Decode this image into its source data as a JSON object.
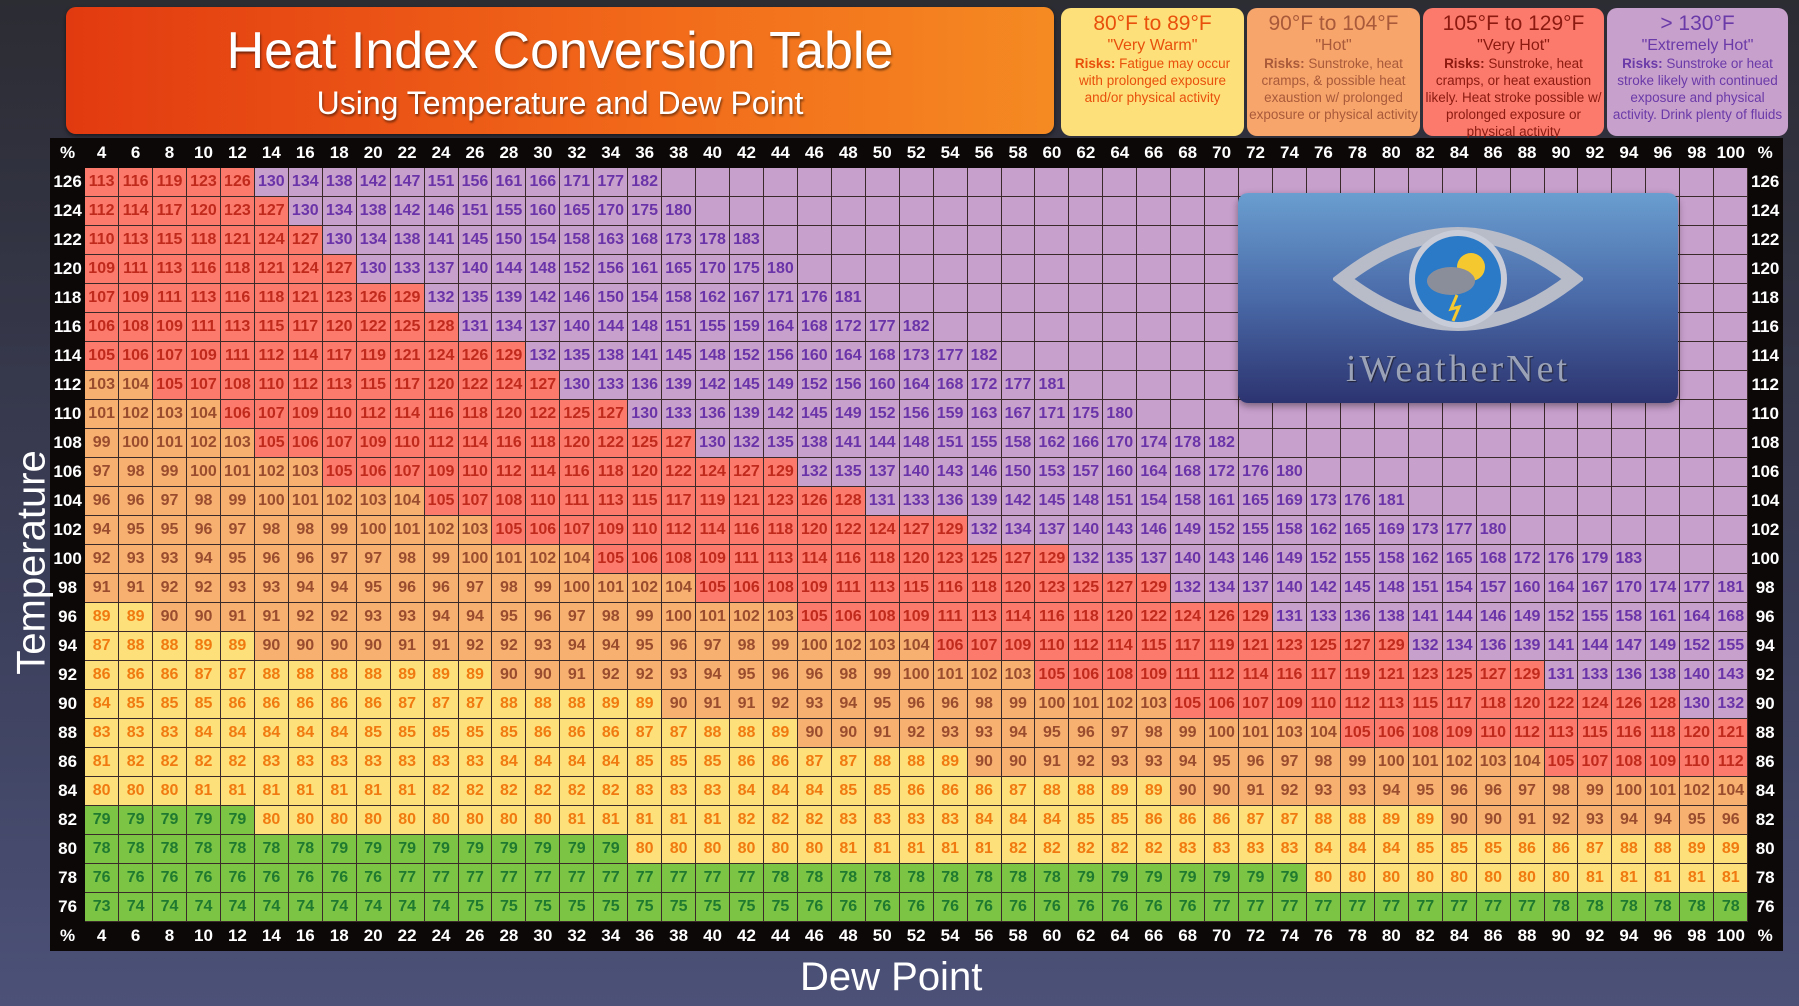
{
  "header": {
    "title": "Heat Index Conversion Table",
    "subtitle": "Using Temperature and Dew Point"
  },
  "legend": [
    {
      "range": "80°F to 89°F",
      "name": "\"Very Warm\"",
      "risks_label": "Risks:",
      "risks": "Fatigue may occur with prolonged exposure and/or physical activity",
      "color": "#fde07a"
    },
    {
      "range": "90°F to 104°F",
      "name": "\"Hot\"",
      "risks_label": "Risks:",
      "risks": "Sunstroke, heat cramps, & possible heat exaustion w/ prolonged exposure or physical activity",
      "color": "#f8b070"
    },
    {
      "range": "105°F to 129°F",
      "name": "\"Very Hot\"",
      "risks_label": "Risks:",
      "risks": "Sunstroke, heat cramps, or heat exaustion likely. Heat stroke possible w/ prolonged exposure or physical activity",
      "color": "#fb7a6c"
    },
    {
      "range": "> 130°F",
      "name": "\"Extremely Hot\"",
      "risks_label": "Risks:",
      "risks": "Sunstroke or heat stroke likely with continued exposure and physical activity. Drink plenty of fluids",
      "color": "#c8a0cc"
    }
  ],
  "logo": {
    "brand": "iWeatherNet"
  },
  "chart_data": {
    "type": "heatmap",
    "title": "Heat Index Conversion Table",
    "subtitle": "Using Temperature and Dew Point",
    "xlabel": "Dew Point",
    "ylabel": "Temperature",
    "corner_label": "%",
    "x": [
      4,
      6,
      8,
      10,
      12,
      14,
      16,
      18,
      20,
      22,
      24,
      26,
      28,
      30,
      32,
      34,
      36,
      38,
      40,
      42,
      44,
      46,
      48,
      50,
      52,
      54,
      56,
      58,
      60,
      62,
      64,
      66,
      68,
      70,
      72,
      74,
      76,
      78,
      80,
      82,
      84,
      86,
      88,
      90,
      92,
      94,
      96,
      98,
      100
    ],
    "y": [
      126,
      124,
      122,
      120,
      118,
      116,
      114,
      112,
      110,
      108,
      106,
      104,
      102,
      100,
      98,
      96,
      94,
      92,
      90,
      88,
      86,
      84,
      82,
      80,
      78,
      76
    ],
    "color_bands": [
      {
        "min": 0,
        "max": 79,
        "color": "#7cc444"
      },
      {
        "min": 80,
        "max": 89,
        "color": "#fde07a"
      },
      {
        "min": 90,
        "max": 104,
        "color": "#f8b070"
      },
      {
        "min": 105,
        "max": 129,
        "color": "#fb7a6c"
      },
      {
        "min": 130,
        "max": 999,
        "color": "#c8a0cc"
      }
    ],
    "values": [
      [
        113,
        116,
        119,
        123,
        126,
        130,
        134,
        138,
        142,
        147,
        151,
        156,
        161,
        166,
        171,
        177,
        182,
        null,
        null,
        null,
        null,
        null,
        null,
        null,
        null,
        null,
        null,
        null,
        null,
        null,
        null,
        null,
        null,
        null,
        null,
        null,
        null,
        null,
        null,
        null,
        null,
        null,
        null,
        null,
        null,
        null,
        null,
        null,
        null
      ],
      [
        112,
        114,
        117,
        120,
        123,
        127,
        130,
        134,
        138,
        142,
        146,
        151,
        155,
        160,
        165,
        170,
        175,
        180,
        null,
        null,
        null,
        null,
        null,
        null,
        null,
        null,
        null,
        null,
        null,
        null,
        null,
        null,
        null,
        null,
        null,
        null,
        null,
        null,
        null,
        null,
        null,
        null,
        null,
        null,
        null,
        null,
        null,
        null,
        null
      ],
      [
        110,
        113,
        115,
        118,
        121,
        124,
        127,
        130,
        134,
        138,
        141,
        145,
        150,
        154,
        158,
        163,
        168,
        173,
        178,
        183,
        null,
        null,
        null,
        null,
        null,
        null,
        null,
        null,
        null,
        null,
        null,
        null,
        null,
        null,
        null,
        null,
        null,
        null,
        null,
        null,
        null,
        null,
        null,
        null,
        null,
        null,
        null,
        null,
        null
      ],
      [
        109,
        111,
        113,
        116,
        118,
        121,
        124,
        127,
        130,
        133,
        137,
        140,
        144,
        148,
        152,
        156,
        161,
        165,
        170,
        175,
        180,
        null,
        null,
        null,
        null,
        null,
        null,
        null,
        null,
        null,
        null,
        null,
        null,
        null,
        null,
        null,
        null,
        null,
        null,
        null,
        null,
        null,
        null,
        null,
        null,
        null,
        null,
        null,
        null
      ],
      [
        107,
        109,
        111,
        113,
        116,
        118,
        121,
        123,
        126,
        129,
        132,
        135,
        139,
        142,
        146,
        150,
        154,
        158,
        162,
        167,
        171,
        176,
        181,
        null,
        null,
        null,
        null,
        null,
        null,
        null,
        null,
        null,
        null,
        null,
        null,
        null,
        null,
        null,
        null,
        null,
        null,
        null,
        null,
        null,
        null,
        null,
        null,
        null,
        null
      ],
      [
        106,
        108,
        109,
        111,
        113,
        115,
        117,
        120,
        122,
        125,
        128,
        131,
        134,
        137,
        140,
        144,
        148,
        151,
        155,
        159,
        164,
        168,
        172,
        177,
        182,
        null,
        null,
        null,
        null,
        null,
        null,
        null,
        null,
        null,
        null,
        null,
        null,
        null,
        null,
        null,
        null,
        null,
        null,
        null,
        null,
        null,
        null,
        null,
        null
      ],
      [
        105,
        106,
        107,
        109,
        111,
        112,
        114,
        117,
        119,
        121,
        124,
        126,
        129,
        132,
        135,
        138,
        141,
        145,
        148,
        152,
        156,
        160,
        164,
        168,
        173,
        177,
        182,
        null,
        null,
        null,
        null,
        null,
        null,
        null,
        null,
        null,
        null,
        null,
        null,
        null,
        null,
        null,
        null,
        null,
        null,
        null,
        null,
        null,
        null
      ],
      [
        103,
        104,
        105,
        107,
        108,
        110,
        112,
        113,
        115,
        117,
        120,
        122,
        124,
        127,
        130,
        133,
        136,
        139,
        142,
        145,
        149,
        152,
        156,
        160,
        164,
        168,
        172,
        177,
        181,
        null,
        null,
        null,
        null,
        null,
        null,
        null,
        null,
        null,
        null,
        null,
        null,
        null,
        null,
        null,
        null,
        null,
        null,
        null,
        null
      ],
      [
        101,
        102,
        103,
        104,
        106,
        107,
        109,
        110,
        112,
        114,
        116,
        118,
        120,
        122,
        125,
        127,
        130,
        133,
        136,
        139,
        142,
        145,
        149,
        152,
        156,
        159,
        163,
        167,
        171,
        175,
        180,
        null,
        null,
        null,
        null,
        null,
        null,
        null,
        null,
        null,
        null,
        null,
        null,
        null,
        null,
        null,
        null,
        null,
        null
      ],
      [
        99,
        100,
        101,
        102,
        103,
        105,
        106,
        107,
        109,
        110,
        112,
        114,
        116,
        118,
        120,
        122,
        125,
        127,
        130,
        132,
        135,
        138,
        141,
        144,
        148,
        151,
        155,
        158,
        162,
        166,
        170,
        174,
        178,
        182,
        null,
        null,
        null,
        null,
        null,
        null,
        null,
        null,
        null,
        null,
        null,
        null,
        null,
        null,
        null
      ],
      [
        97,
        98,
        99,
        100,
        101,
        102,
        103,
        105,
        106,
        107,
        109,
        110,
        112,
        114,
        116,
        118,
        120,
        122,
        124,
        127,
        129,
        132,
        135,
        137,
        140,
        143,
        146,
        150,
        153,
        157,
        160,
        164,
        168,
        172,
        176,
        180,
        null,
        null,
        null,
        null,
        null,
        null,
        null,
        null,
        null,
        null,
        null,
        null,
        null
      ],
      [
        96,
        96,
        97,
        98,
        99,
        100,
        101,
        102,
        103,
        104,
        105,
        107,
        108,
        110,
        111,
        113,
        115,
        117,
        119,
        121,
        123,
        126,
        128,
        131,
        133,
        136,
        139,
        142,
        145,
        148,
        151,
        154,
        158,
        161,
        165,
        169,
        173,
        176,
        181,
        null,
        null,
        null,
        null,
        null,
        null,
        null,
        null,
        null,
        null
      ],
      [
        94,
        95,
        95,
        96,
        97,
        98,
        98,
        99,
        100,
        101,
        102,
        103,
        105,
        106,
        107,
        109,
        110,
        112,
        114,
        116,
        118,
        120,
        122,
        124,
        127,
        129,
        132,
        134,
        137,
        140,
        143,
        146,
        149,
        152,
        155,
        158,
        162,
        165,
        169,
        173,
        177,
        180,
        null,
        null,
        null,
        null,
        null,
        null,
        null
      ],
      [
        92,
        93,
        93,
        94,
        95,
        96,
        96,
        97,
        97,
        98,
        99,
        100,
        101,
        102,
        104,
        105,
        106,
        108,
        109,
        111,
        113,
        114,
        116,
        118,
        120,
        123,
        125,
        127,
        129,
        132,
        135,
        137,
        140,
        143,
        146,
        149,
        152,
        155,
        158,
        162,
        165,
        168,
        172,
        176,
        179,
        183,
        null,
        null,
        null
      ],
      [
        91,
        91,
        92,
        92,
        93,
        93,
        94,
        94,
        95,
        96,
        96,
        97,
        98,
        99,
        100,
        101,
        102,
        104,
        105,
        106,
        108,
        109,
        111,
        113,
        115,
        116,
        118,
        120,
        123,
        125,
        127,
        129,
        132,
        134,
        137,
        140,
        142,
        145,
        148,
        151,
        154,
        157,
        160,
        164,
        167,
        170,
        174,
        177,
        181
      ],
      [
        89,
        89,
        90,
        90,
        91,
        91,
        92,
        92,
        93,
        93,
        94,
        94,
        95,
        96,
        97,
        98,
        99,
        100,
        101,
        102,
        103,
        105,
        106,
        108,
        109,
        111,
        113,
        114,
        116,
        118,
        120,
        122,
        124,
        126,
        129,
        131,
        133,
        136,
        138,
        141,
        144,
        146,
        149,
        152,
        155,
        158,
        161,
        164,
        168
      ],
      [
        87,
        88,
        88,
        89,
        89,
        90,
        90,
        90,
        90,
        91,
        91,
        92,
        92,
        93,
        94,
        94,
        95,
        96,
        97,
        98,
        99,
        100,
        102,
        103,
        104,
        106,
        107,
        109,
        110,
        112,
        114,
        115,
        117,
        119,
        121,
        123,
        125,
        127,
        129,
        132,
        134,
        136,
        139,
        141,
        144,
        147,
        149,
        152,
        155
      ],
      [
        86,
        86,
        86,
        87,
        87,
        88,
        88,
        88,
        88,
        89,
        89,
        89,
        90,
        90,
        91,
        92,
        92,
        93,
        94,
        95,
        96,
        96,
        98,
        99,
        100,
        101,
        102,
        103,
        105,
        106,
        108,
        109,
        111,
        112,
        114,
        116,
        117,
        119,
        121,
        123,
        125,
        127,
        129,
        131,
        133,
        136,
        138,
        140,
        143
      ],
      [
        84,
        85,
        85,
        85,
        86,
        86,
        86,
        86,
        86,
        87,
        87,
        87,
        88,
        88,
        88,
        89,
        89,
        90,
        91,
        91,
        92,
        93,
        94,
        95,
        96,
        96,
        98,
        99,
        100,
        101,
        102,
        103,
        105,
        106,
        107,
        109,
        110,
        112,
        113,
        115,
        117,
        118,
        120,
        122,
        124,
        126,
        128,
        130,
        132
      ],
      [
        83,
        83,
        83,
        84,
        84,
        84,
        84,
        84,
        85,
        85,
        85,
        85,
        85,
        86,
        86,
        86,
        87,
        87,
        88,
        88,
        89,
        90,
        90,
        91,
        92,
        93,
        93,
        94,
        95,
        96,
        97,
        98,
        99,
        100,
        101,
        103,
        104,
        105,
        106,
        108,
        109,
        110,
        112,
        113,
        115,
        116,
        118,
        120,
        121
      ],
      [
        81,
        82,
        82,
        82,
        82,
        83,
        83,
        83,
        83,
        83,
        83,
        83,
        84,
        84,
        84,
        84,
        85,
        85,
        85,
        86,
        86,
        87,
        87,
        88,
        88,
        89,
        90,
        90,
        91,
        92,
        93,
        93,
        94,
        95,
        96,
        97,
        98,
        99,
        100,
        101,
        102,
        103,
        104,
        105,
        107,
        108,
        109,
        110,
        112
      ],
      [
        80,
        80,
        80,
        81,
        81,
        81,
        81,
        81,
        81,
        81,
        82,
        82,
        82,
        82,
        82,
        82,
        83,
        83,
        83,
        84,
        84,
        84,
        85,
        85,
        86,
        86,
        86,
        87,
        88,
        88,
        89,
        89,
        90,
        90,
        91,
        92,
        93,
        93,
        94,
        95,
        96,
        96,
        97,
        98,
        99,
        100,
        101,
        102,
        104
      ],
      [
        79,
        79,
        79,
        79,
        79,
        80,
        80,
        80,
        80,
        80,
        80,
        80,
        80,
        80,
        81,
        81,
        81,
        81,
        81,
        82,
        82,
        82,
        83,
        83,
        83,
        83,
        84,
        84,
        84,
        85,
        85,
        86,
        86,
        86,
        87,
        87,
        88,
        88,
        89,
        89,
        90,
        90,
        91,
        92,
        93,
        94,
        94,
        95,
        96
      ],
      [
        78,
        78,
        78,
        78,
        78,
        78,
        78,
        79,
        79,
        79,
        79,
        79,
        79,
        79,
        79,
        79,
        80,
        80,
        80,
        80,
        80,
        80,
        81,
        81,
        81,
        81,
        81,
        82,
        82,
        82,
        82,
        82,
        83,
        83,
        83,
        83,
        84,
        84,
        84,
        85,
        85,
        85,
        86,
        86,
        87,
        88,
        88,
        89,
        89
      ],
      [
        76,
        76,
        76,
        76,
        76,
        76,
        76,
        76,
        76,
        77,
        77,
        77,
        77,
        77,
        77,
        77,
        77,
        77,
        77,
        77,
        78,
        78,
        78,
        78,
        78,
        78,
        78,
        78,
        78,
        79,
        79,
        79,
        79,
        79,
        79,
        79,
        80,
        80,
        80,
        80,
        80,
        80,
        80,
        80,
        81,
        81,
        81,
        81,
        81
      ],
      [
        73,
        74,
        74,
        74,
        74,
        74,
        74,
        74,
        74,
        74,
        74,
        75,
        75,
        75,
        75,
        75,
        75,
        75,
        75,
        75,
        75,
        76,
        76,
        76,
        76,
        76,
        76,
        76,
        76,
        76,
        76,
        76,
        76,
        77,
        77,
        77,
        77,
        77,
        77,
        77,
        77,
        77,
        77,
        78,
        78,
        78,
        78,
        78,
        78
      ]
    ]
  }
}
